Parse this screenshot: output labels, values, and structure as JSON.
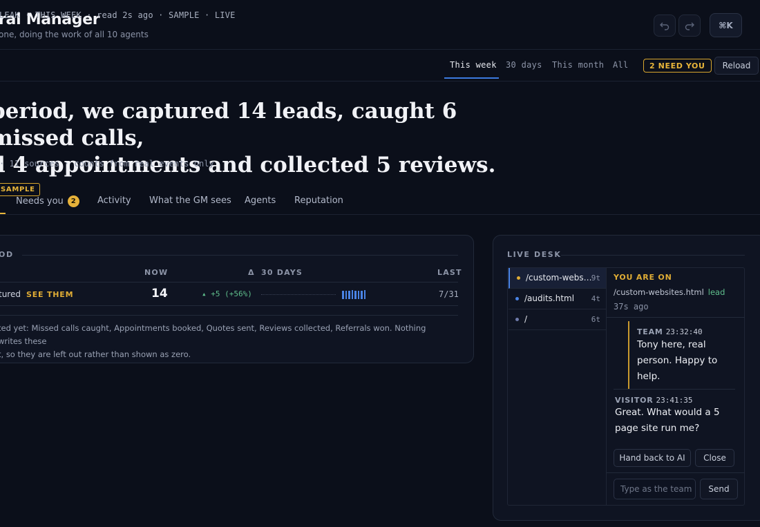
{
  "header": {
    "title": "ral Manager",
    "subtitle": "one, doing the work of all 10 agents",
    "undo_icon": "undo-icon",
    "redo_icon": "redo-icon",
    "cmdk_label": "⌘K"
  },
  "status": {
    "line": "LEAK · THIS WEEK · read 2s ago · SAMPLE · LIVE",
    "ranges": [
      "This week",
      "30 days",
      "This month",
      "All"
    ],
    "active_range": "This week",
    "need_you_badge": "2 NEED YOU",
    "reload_label": "Reload"
  },
  "headline": {
    "line1": "period, we captured 14 leads, caught 6 missed calls,",
    "line2": "d 4 appointments and collected 5 reviews.",
    "sample_tag": "SAMPLE",
    "sources": "· 11 sources · counts from real events only"
  },
  "tabs": {
    "needs_you": "Needs you",
    "needs_you_count": "2",
    "activity": "Activity",
    "gm_sees": "What the GM sees",
    "agents": "Agents",
    "reputation": "Reputation"
  },
  "period_card": {
    "label": "OD",
    "col_now": "NOW",
    "col_delta": "Δ",
    "col_30": "30 DAYS",
    "col_last": "LAST",
    "row_label": "tured",
    "see_link": "SEE THEM",
    "now_value": "14",
    "delta": "▴ +5 (+56%)",
    "sparkline": [
      0.95,
      0.9,
      0.95,
      1.0,
      0.9,
      0.95,
      0.95,
      1.0
    ],
    "last_value": "7/31",
    "note_line1": "ted yet: Missed calls caught, Appointments booked, Quotes sent, Reviews collected, Referrals won. Nothing writes these",
    "note_line2": "t, so they are left out rather than shown as zero."
  },
  "live_desk": {
    "label": "LIVE DESK",
    "pages": [
      {
        "path": "/custom-webs…",
        "count": "9t",
        "dot": "#e0ad35",
        "active": true
      },
      {
        "path": "/audits.html",
        "count": "4t",
        "dot": "#4a84e6",
        "active": false
      },
      {
        "path": "/",
        "count": "6t",
        "dot": "#6f7bab",
        "active": false
      }
    ],
    "you_are_on": "YOU ARE ON",
    "current_path": "/custom-websites.html",
    "current_tag": "lead",
    "current_ago": "37s ago",
    "team_role": "TEAM",
    "team_time": "23:32:40",
    "team_msg": "Tony here, real person. Happy to help.",
    "visitor_role": "VISITOR",
    "visitor_time": "23:41:35",
    "visitor_msg": "Great. What would a 5 page site run me?",
    "hand_back_label": "Hand back to AI",
    "close_label": "Close",
    "compose_placeholder": "Type as the team",
    "send_label": "Send"
  },
  "colors": {
    "accent": "#4a84e6",
    "warning": "#e0ad35",
    "positive": "#5fbf8c",
    "background": "#0b0f1a"
  }
}
